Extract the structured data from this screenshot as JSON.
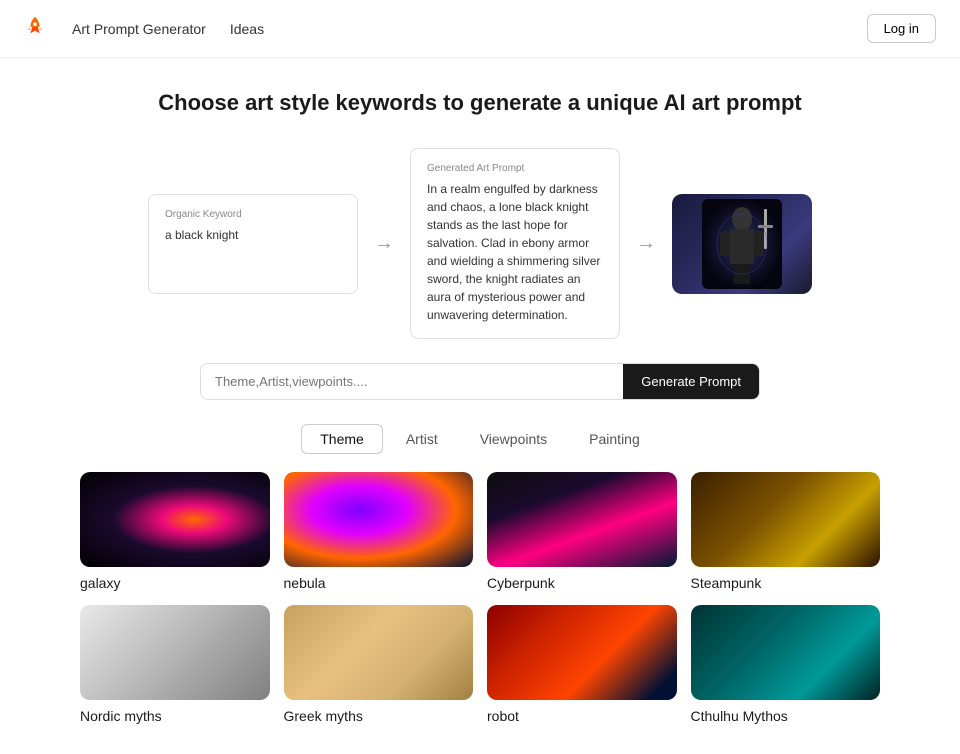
{
  "nav": {
    "links": [
      {
        "id": "art-prompt-generator",
        "label": "Art Prompt Generator"
      },
      {
        "id": "ideas",
        "label": "Ideas"
      }
    ],
    "login_label": "Log in"
  },
  "hero": {
    "title": "Choose art style keywords to generate a unique AI art prompt"
  },
  "demo": {
    "organic_keyword_label": "Organic Keyword",
    "organic_keyword_value": "a black knight",
    "generated_prompt_label": "Generated Art Prompt",
    "generated_prompt_value": "In a realm engulfed by darkness and chaos, a lone black knight stands as the last hope for salvation. Clad in ebony armor and wielding a shimmering silver sword, the knight radiates an aura of mysterious power and unwavering determination."
  },
  "search": {
    "placeholder": "Theme,Artist,viewpoints....",
    "button_label": "Generate Prompt"
  },
  "tabs": [
    {
      "id": "theme",
      "label": "Theme",
      "active": true
    },
    {
      "id": "artist",
      "label": "Artist",
      "active": false
    },
    {
      "id": "viewpoints",
      "label": "Viewpoints",
      "active": false
    },
    {
      "id": "painting",
      "label": "Painting",
      "active": false
    }
  ],
  "grid_items": [
    {
      "id": "galaxy",
      "label": "galaxy",
      "img_class": "img-galaxy"
    },
    {
      "id": "nebula",
      "label": "nebula",
      "img_class": "img-nebula"
    },
    {
      "id": "cyberpunk",
      "label": "Cyberpunk",
      "img_class": "img-cyberpunk"
    },
    {
      "id": "steampunk",
      "label": "Steampunk",
      "img_class": "img-steampunk"
    },
    {
      "id": "nordic-myths",
      "label": "Nordic myths",
      "img_class": "img-nordic"
    },
    {
      "id": "greek-myths",
      "label": "Greek myths",
      "img_class": "img-greek"
    },
    {
      "id": "robot",
      "label": "robot",
      "img_class": "img-robot"
    },
    {
      "id": "cthulhu-mythos",
      "label": "Cthulhu Mythos",
      "img_class": "img-cthulhu"
    }
  ]
}
